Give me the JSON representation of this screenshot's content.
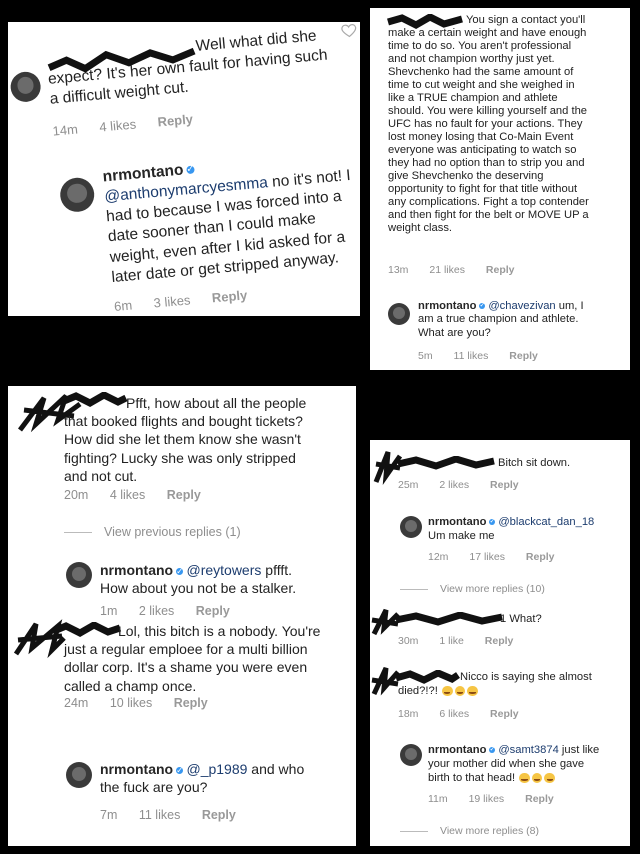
{
  "p1": {
    "c1": {
      "line1": "Well what did she",
      "line2": "expect? It's her own fault for having such",
      "line3": "a difficult weight cut.",
      "time": "14m",
      "likes": "4 likes",
      "reply": "Reply"
    },
    "r1": {
      "user": "nrmontano",
      "mention": "@anthonymarcyesmma",
      "line1_rest": " no it's not! I",
      "line2": "had to because I was forced into a",
      "line3": "date sooner than I could make",
      "line4": "weight, even after I kid asked for a",
      "line5": "later date or get stripped anyway.",
      "time": "6m",
      "likes": "3 likes",
      "reply": "Reply"
    }
  },
  "p2": {
    "c1": {
      "lines": [
        "You sign a contact you'll",
        "make a certain weight and have enough",
        "time to do so. You aren't professional",
        "and not champion worthy just yet.",
        "Shevchenko had the same amount of",
        "time to cut weight and she weighed in",
        "like a TRUE champion and athlete",
        "should. You were killing yourself and the",
        "UFC has no fault for your actions. They",
        "lost money losing that Co-Main Event",
        "everyone was anticipating to watch so",
        "they had no option than to strip you and",
        "give Shevchenko the deserving",
        "opportunity to fight for that title without",
        "any complications. Fight a top contender",
        "and then fight for the belt or MOVE UP a",
        "weight class."
      ],
      "time": "13m",
      "likes": "21 likes",
      "reply": "Reply"
    },
    "r1": {
      "user": "nrmontano",
      "mention": "@chavezivan",
      "line1_rest": " um, I",
      "line2": "am a true champion and athlete.",
      "line3": "What are you?",
      "time": "5m",
      "likes": "11 likes",
      "reply": "Reply"
    }
  },
  "p3": {
    "c1": {
      "lines": [
        "Pfft, how about all the people",
        "that booked flights and bought tickets?",
        "How did she let them know she wasn't",
        "fighting? Lucky she was only stripped",
        "and not cut."
      ],
      "time": "20m",
      "likes": "4 likes",
      "reply": "Reply"
    },
    "view_prev": "View previous replies (1)",
    "r1": {
      "user": "nrmontano",
      "mention": "@reytowers",
      "line1_rest": " pffft.",
      "line2": "How about you not be a stalker.",
      "time": "1m",
      "likes": "2 likes",
      "reply": "Reply"
    },
    "c2": {
      "lines": [
        "Lol, this bitch is a nobody. You're",
        "just a regular emploee for a multi billion",
        "dollar corp. It's a shame you were even",
        "called a champ once."
      ],
      "time": "24m",
      "likes": "10 likes",
      "reply": "Reply"
    },
    "r2": {
      "user": "nrmontano",
      "mention": "@_p1989",
      "line1_rest": " and who",
      "line2": "the fuck are you?",
      "time": "7m",
      "likes": "11 likes",
      "reply": "Reply"
    }
  },
  "p4": {
    "c1": {
      "text": "Bitch sit down.",
      "time": "25m",
      "likes": "2 likes",
      "reply": "Reply"
    },
    "r1": {
      "user": "nrmontano",
      "mention": "@blackcat_dan_18",
      "line2": "Um make me",
      "time": "12m",
      "likes": "17 likes",
      "reply": "Reply"
    },
    "view_more1": "View more replies (10)",
    "c2": {
      "text": "1 What?",
      "time": "30m",
      "likes": "1 like",
      "reply": "Reply"
    },
    "c3": {
      "line1": "Nicco is saying she almost",
      "line2": "died?!?!",
      "time": "18m",
      "likes": "6 likes",
      "reply": "Reply"
    },
    "r2": {
      "user": "nrmontano",
      "mention": "@samt3874",
      "line1_rest": " just like",
      "line2": "your mother did when she gave",
      "line3": "birth to that head!",
      "time": "11m",
      "likes": "19 likes",
      "reply": "Reply"
    },
    "view_more2": "View more replies (8)"
  },
  "colors": {
    "background": "#000000",
    "panel": "#ffffff",
    "verified": "#3897f0",
    "mention": "#1c3c6e",
    "meta": "#8e8e8e"
  }
}
